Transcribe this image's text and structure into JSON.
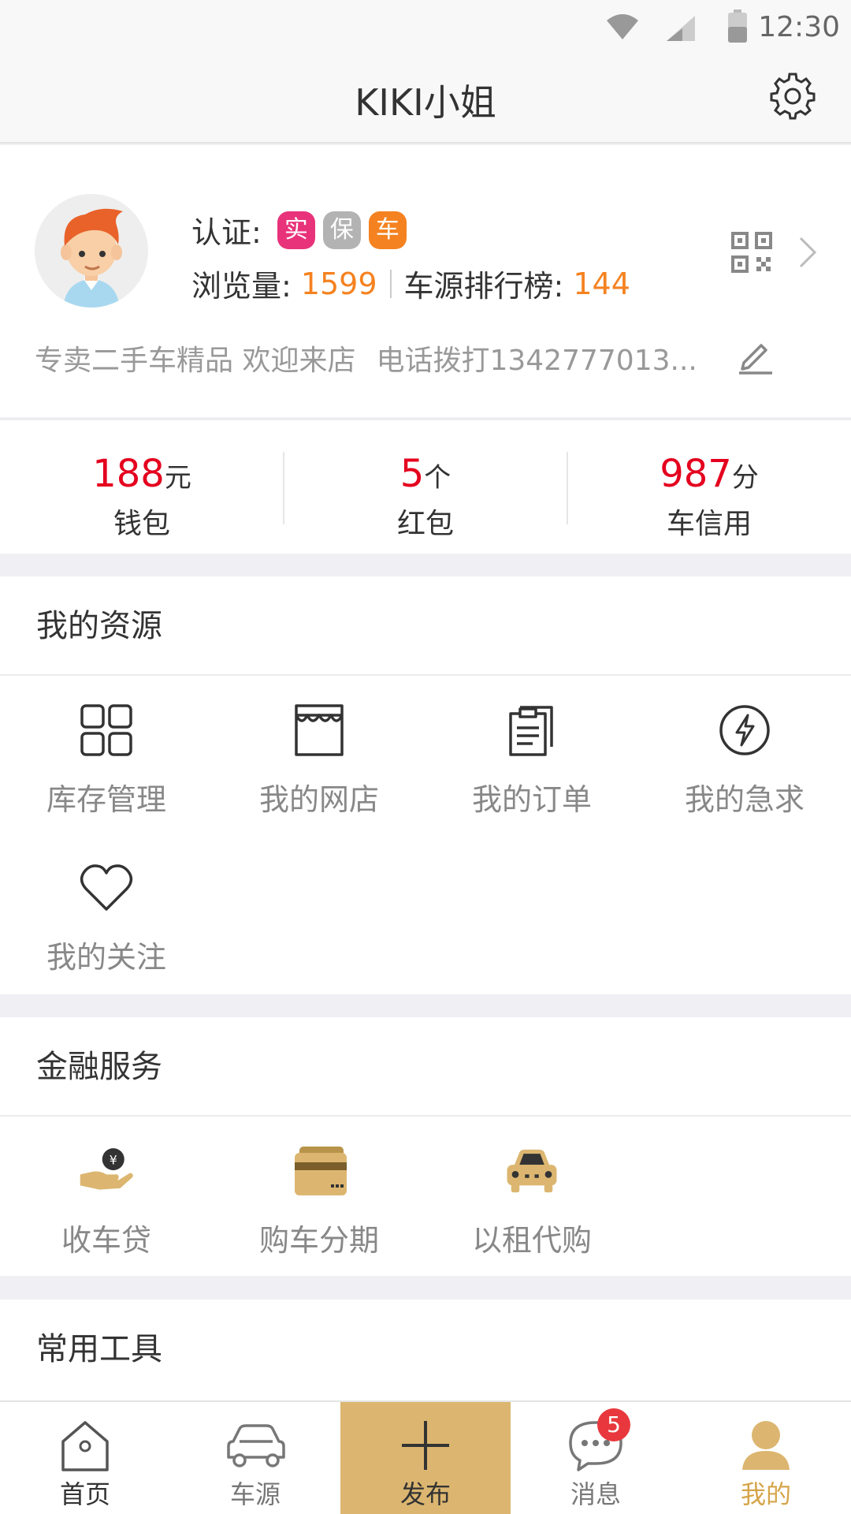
{
  "status_bar": {
    "time": "12:30"
  },
  "header": {
    "title": "KIKI小姐"
  },
  "profile": {
    "cert_label": "认证:",
    "badges": [
      {
        "text": "实",
        "color": "#e8337a"
      },
      {
        "text": "保",
        "color": "#b3b3b3"
      },
      {
        "text": "车",
        "color": "#f58220"
      }
    ],
    "views_label": "浏览量:",
    "views_value": "1599",
    "rank_label": "车源排行榜:",
    "rank_value": "144",
    "intro_text": "专卖二手车精品 欢迎来店",
    "intro_phone": "电话拨打1342777013..."
  },
  "wallet": [
    {
      "value": "188",
      "unit": "元",
      "label": "钱包"
    },
    {
      "value": "5",
      "unit": "个",
      "label": "红包"
    },
    {
      "value": "987",
      "unit": "分",
      "label": "车信用"
    }
  ],
  "resources": {
    "title": "我的资源",
    "items": [
      {
        "label": "库存管理",
        "icon": "grid-icon"
      },
      {
        "label": "我的网店",
        "icon": "store-icon"
      },
      {
        "label": "我的订单",
        "icon": "order-icon"
      },
      {
        "label": "我的急求",
        "icon": "lightning-icon"
      },
      {
        "label": "我的关注",
        "icon": "heart-icon"
      }
    ]
  },
  "finance": {
    "title": "金融服务",
    "items": [
      {
        "label": "收车贷",
        "icon": "loan-hand-icon"
      },
      {
        "label": "购车分期",
        "icon": "card-icon"
      },
      {
        "label": "以租代购",
        "icon": "car-front-icon"
      }
    ]
  },
  "tools": {
    "title": "常用工具"
  },
  "tabbar": {
    "items": [
      {
        "label": "首页",
        "icon": "home-icon"
      },
      {
        "label": "车源",
        "icon": "car-icon"
      },
      {
        "label": "发布",
        "icon": "plus-icon"
      },
      {
        "label": "消息",
        "icon": "chat-icon",
        "badge": "5"
      },
      {
        "label": "我的",
        "icon": "user-icon",
        "active": true
      }
    ]
  },
  "colors": {
    "accent": "#dcb670",
    "price_red": "#e4001e",
    "number_orange": "#f58220",
    "badge_red": "#e8383d"
  }
}
